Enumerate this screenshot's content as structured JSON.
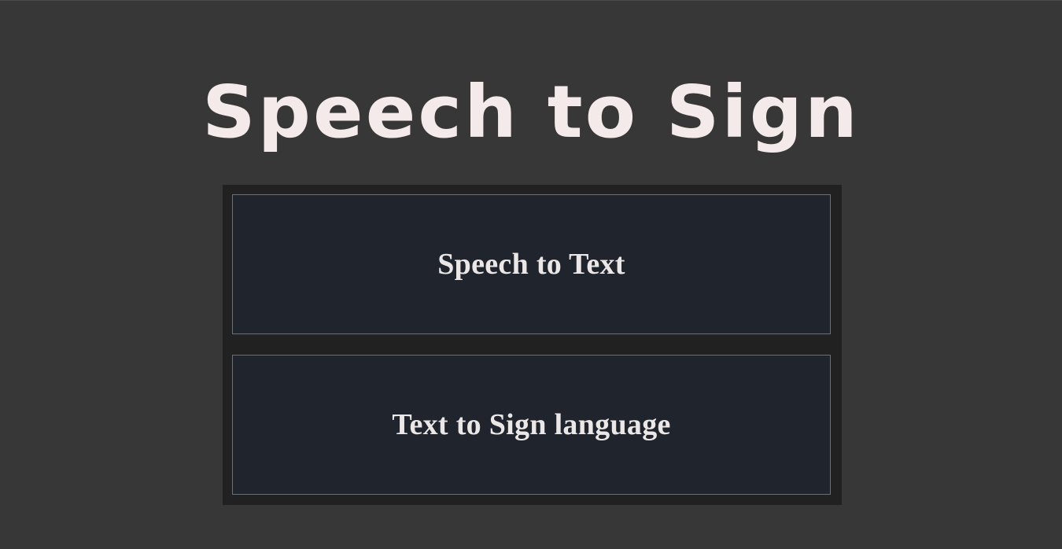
{
  "header": {
    "title": "Speech to Sign"
  },
  "menu": {
    "options": [
      {
        "label": "Speech to Text"
      },
      {
        "label": "Text to Sign language"
      }
    ]
  },
  "colors": {
    "background": "#373737",
    "panel": "#222122",
    "button_fill": "#20252d",
    "button_border": "#6b7078",
    "text": "#f5eaea"
  }
}
